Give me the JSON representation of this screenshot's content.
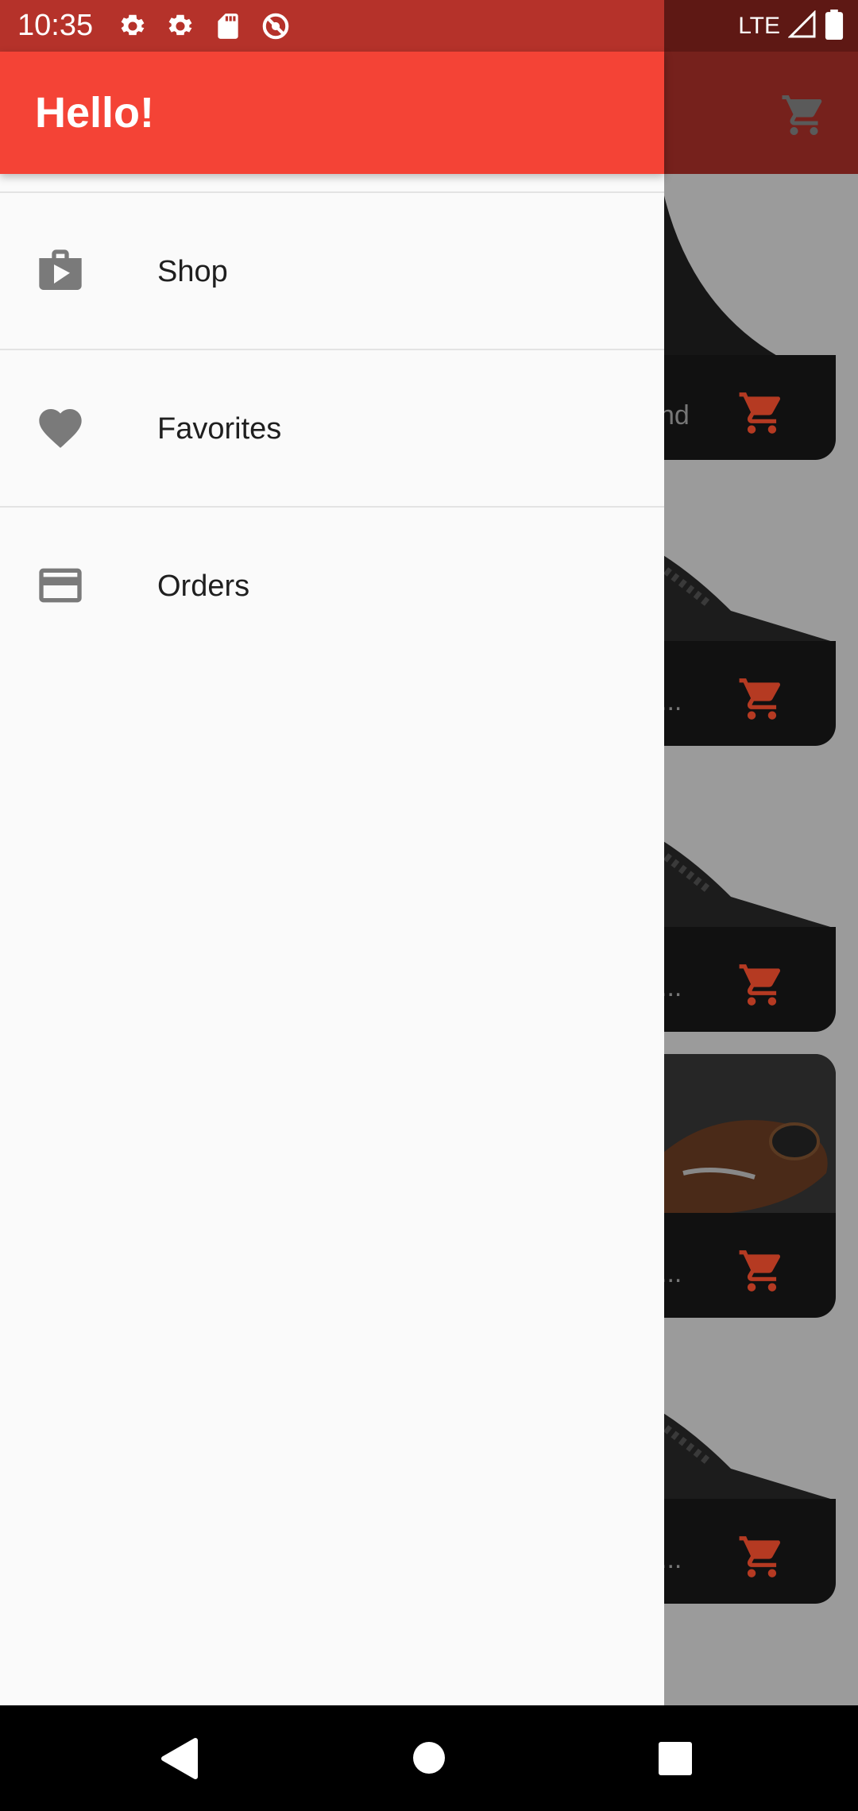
{
  "status_bar": {
    "time": "10:35",
    "network": "LTE",
    "icons": [
      "settings-icon",
      "settings-icon",
      "sd-card-icon",
      "no-disturb-icon",
      "signal-icon",
      "battery-icon"
    ]
  },
  "drawer": {
    "title": "Hello!",
    "items": [
      {
        "label": "Shop",
        "icon": "shop-icon"
      },
      {
        "label": "Favorites",
        "icon": "heart-icon"
      },
      {
        "label": "Orders",
        "icon": "credit-card-icon"
      }
    ]
  },
  "background": {
    "card_texts": [
      "nd",
      "...",
      "...",
      "...",
      "..."
    ]
  },
  "colors": {
    "accent": "#f44336",
    "status_bar": "#b5322a",
    "cart_icon": "#b53a22"
  }
}
